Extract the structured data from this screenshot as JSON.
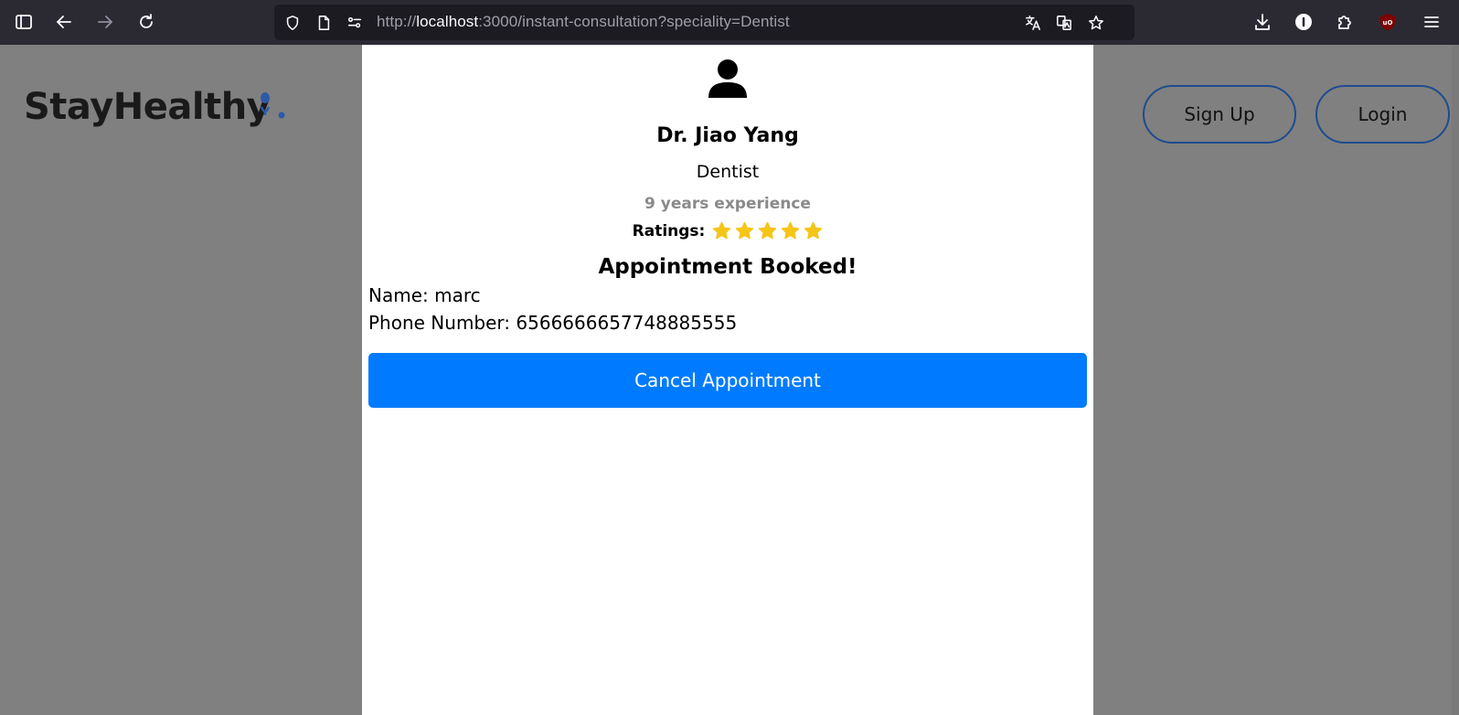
{
  "browser": {
    "url_scheme": "http://",
    "url_host": "localhost",
    "url_rest": ":3000/instant-consultation?speciality=Dentist"
  },
  "site": {
    "logo_text": "StayHealthy",
    "nav": {
      "signup_label": "Sign Up",
      "login_label": "Login"
    }
  },
  "doctor": {
    "name": "Dr. Jiao Yang",
    "speciality": "Dentist",
    "experience": "9 years experience",
    "ratings_label": "Ratings:",
    "rating_stars": 5
  },
  "booking": {
    "heading": "Appointment Booked!",
    "name_line": "Name: marc",
    "phone_line": "Phone Number: 6566666657748885555",
    "cancel_label": "Cancel Appointment"
  },
  "colors": {
    "primary": "#007bff",
    "star": "#f5c518",
    "nav_border": "#1e4b8f",
    "overlay": "#808080"
  }
}
